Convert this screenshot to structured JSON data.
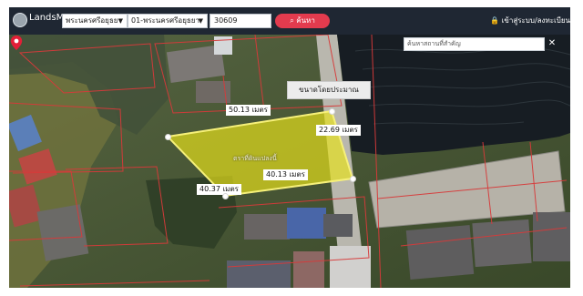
{
  "app": {
    "brand": "LandsMaps",
    "province": "พระนครศรีอยุธยา",
    "district": "01-พระนครศรีอยุธยา",
    "parcel_no": "30609",
    "search_label": "ค้นหา",
    "login_label": "เข้าสู่ระบบ/ลงทะเบียน",
    "place_search_placeholder": "ค้นหาสถานที่สำคัญ",
    "close_icon": "close-icon"
  },
  "map": {
    "approx_label": "ขนาดโดยประมาณ",
    "center_name": "ตราที่ดินแปลงนี้",
    "measurements": [
      "50.13 เมตร",
      "22.69 เมตร",
      "40.13 เมตร",
      "40.37 เมตร"
    ],
    "colors": {
      "parcel_fill": "#e8e21a",
      "parcel_stroke": "#f6f07a",
      "boundary": "#d73a3a",
      "water": "#171d23",
      "topbar": "#1f2733",
      "accent": "#e33b4e"
    }
  }
}
